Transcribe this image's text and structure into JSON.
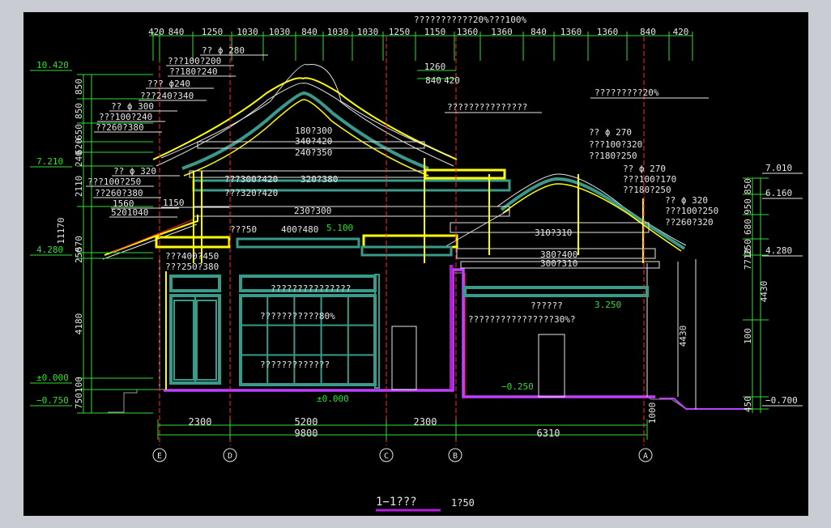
{
  "dims_top": [
    "420",
    "840",
    "1250",
    "1030",
    "1030",
    "840",
    "1030",
    "1030",
    "1250",
    "1150",
    "1360",
    "1360",
    "840",
    "1360",
    "1360",
    "840",
    "420"
  ],
  "dims_top_sub": [
    "1260",
    "840",
    "420"
  ],
  "dims_bottom_seg": [
    "2300",
    "5200",
    "2300"
  ],
  "dims_bottom_total": [
    "9800",
    "6310"
  ],
  "axes": [
    "E",
    "D",
    "C",
    "B",
    "A"
  ],
  "left_elevations": [
    "10.420",
    "7.210",
    "4.280",
    "±0.000",
    "−0.750"
  ],
  "right_elevations": [
    "7.010",
    "6.160",
    "4.280",
    "−0.700"
  ],
  "left_vertical_dims": [
    "850",
    "850",
    "650",
    "620",
    "240",
    "2110",
    "250",
    "570",
    "4180",
    "100",
    "750"
  ],
  "left_total": "11170",
  "right_vertical_dims": [
    "850",
    "950",
    "680",
    "250",
    "7710",
    "4430",
    "4430",
    "100",
    "450",
    "1000"
  ],
  "notes_top": [
    "???????????20%???100%",
    "?????????20%",
    "???????????????"
  ],
  "left_notes": [
    "?? ϕ 280",
    "???100?200",
    "??180?240",
    "??? ϕ240",
    "???240?340",
    "?? ϕ 300",
    "???100?240",
    "??260?380",
    "?? ϕ 320",
    "???100?250",
    "??260?380",
    "1560",
    "1150",
    "5201040"
  ],
  "center_labels": [
    "180?300",
    "340?420",
    "240?350",
    "???300?420",
    "320?380",
    "???320?420",
    "230?300",
    "???50",
    "400?480",
    "5.100",
    "???400?450",
    "???250?380",
    "???????????????",
    "???????????80%",
    "?????????????",
    "±0.000",
    "−0.250"
  ],
  "right_labels": [
    "?? ϕ 270",
    "???100?320",
    "??180?250",
    "?? ϕ 270",
    "???100?170",
    "??180?250",
    "?? ϕ 320",
    "???100?250",
    "??260?320",
    "310?310",
    "380?400",
    "300?310",
    "??????",
    "3.250",
    "????????????????30%?"
  ],
  "title": "1−1???",
  "scale": "1?50"
}
